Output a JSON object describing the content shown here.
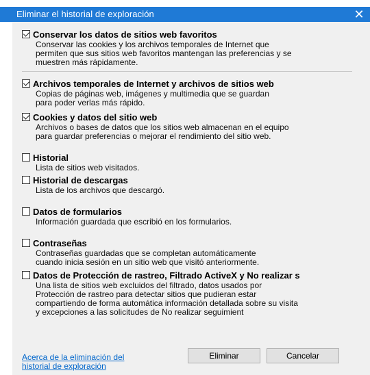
{
  "dialog": {
    "title": "Eliminar el historial de exploración",
    "close_glyph": "✕"
  },
  "options": [
    {
      "title": "Conservar los datos de sitios web favoritos",
      "checked": true,
      "description": "Conservar las cookies y los archivos temporales de Internet que\npermiten que sus sitios web favoritos mantengan las preferencias y se\nmuestren más rápidamente."
    },
    {
      "title": "Archivos temporales de Internet y archivos de sitios web",
      "checked": true,
      "description": "Copias de páginas web, imágenes y multimedia que se guardan\npara poder verlas más rápido."
    },
    {
      "title": "Cookies y datos del sitio web",
      "checked": true,
      "description": "Archivos o bases de datos que los sitios web almacenan en el equipo\npara guardar preferencias o mejorar el rendimiento del sitio web."
    },
    {
      "title": "Historial",
      "checked": false,
      "description": "Lista de sitios web visitados."
    },
    {
      "title": "Historial de descargas",
      "checked": false,
      "description": "Lista de los archivos que descargó."
    },
    {
      "title": "Datos de formularios",
      "checked": false,
      "description": "Información guardada que escribió en los formularios."
    },
    {
      "title": "Contraseñas",
      "checked": false,
      "description": "Contraseñas guardadas que se completan automáticamente\ncuando inicia sesión en un sitio web que visitó anteriormente."
    },
    {
      "title": "Datos de Protección de rastreo, Filtrado ActiveX y No realizar s",
      "checked": false,
      "description": "Una lista de sitios web excluidos del filtrado, datos usados por\nProtección de rastreo para detectar sitios que pudieran estar\ncompartiendo de forma automática información detallada sobre su visita\ny excepciones a las solicitudes de No realizar seguimient"
    }
  ],
  "footer": {
    "link_text": "Acerca de la eliminación del\nhistorial de exploración",
    "delete_label": "Eliminar",
    "cancel_label": "Cancelar"
  },
  "colors": {
    "titlebar": "#1f7ad6",
    "dialog_bg": "#f0f0f0",
    "link": "#0066cc"
  }
}
